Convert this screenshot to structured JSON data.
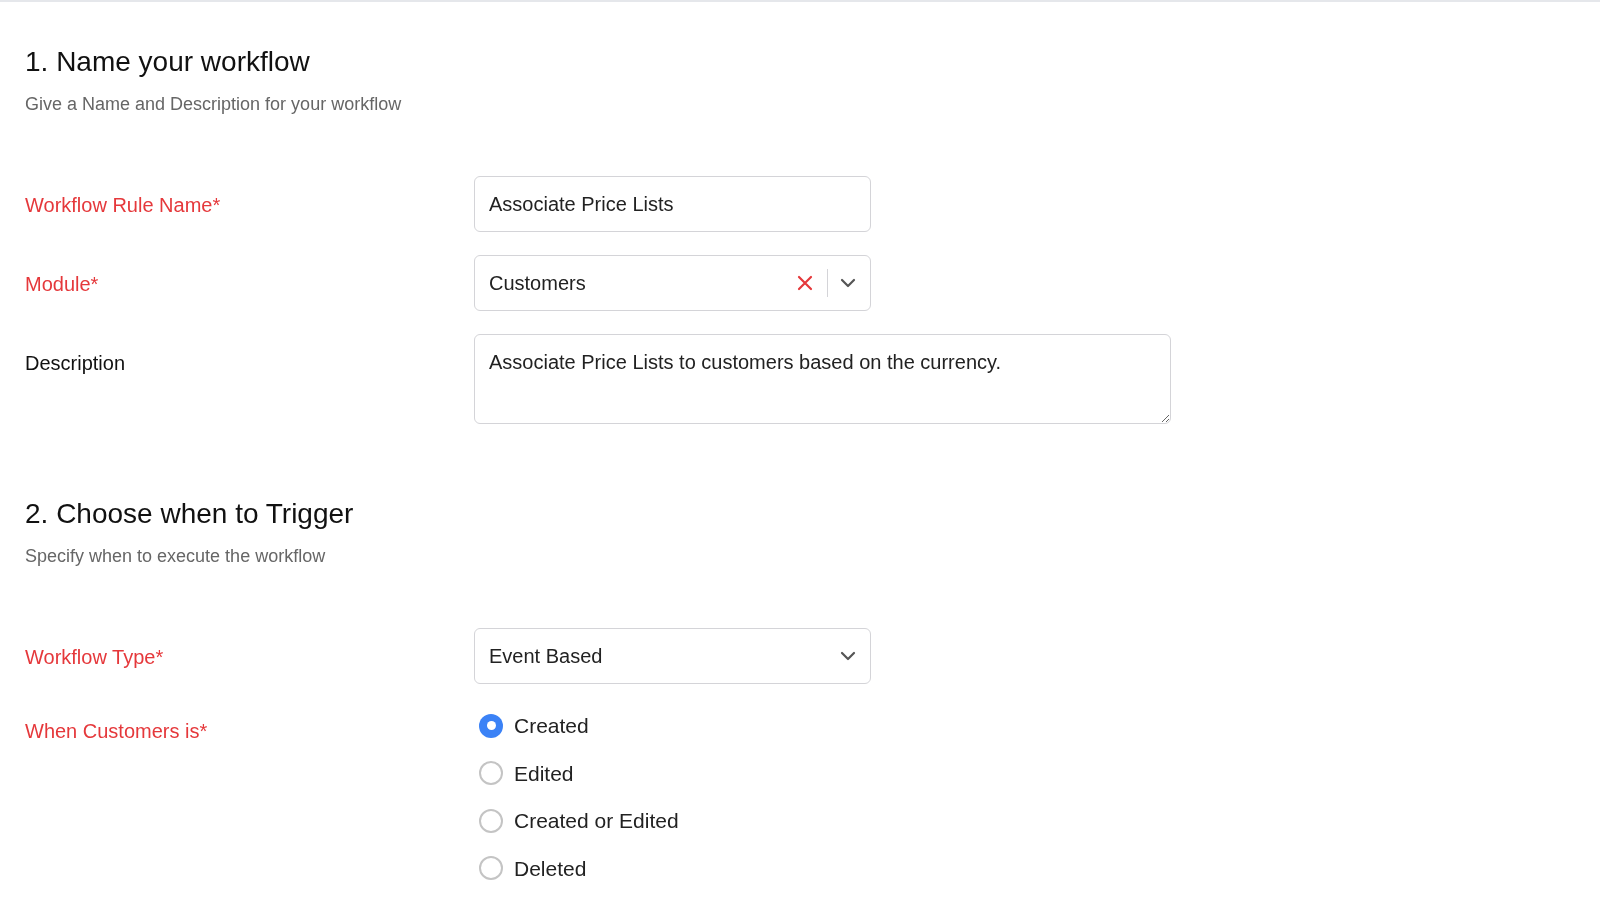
{
  "section_1": {
    "title": "1. Name your workflow",
    "subtitle": "Give a Name and Description for your workflow"
  },
  "fields_1": [
    {
      "kind": "text",
      "label": "Workflow Rule Name*",
      "required": true,
      "value": "Associate Price Lists"
    },
    {
      "kind": "select_clearable",
      "label": "Module*",
      "required": true,
      "value": "Customers"
    },
    {
      "kind": "textarea",
      "label": "Description",
      "required": false,
      "value": "Associate Price Lists to customers based on the currency."
    }
  ],
  "section_2": {
    "title": "2. Choose when to Trigger",
    "subtitle": "Specify when to execute the workflow"
  },
  "fields_2": [
    {
      "kind": "select",
      "label": "Workflow Type*",
      "required": true,
      "value": "Event Based"
    }
  ],
  "trigger": {
    "label": "When Customers is*",
    "required": true,
    "options": [
      {
        "label": "Created",
        "selected": true
      },
      {
        "label": "Edited",
        "selected": false
      },
      {
        "label": "Created or Edited",
        "selected": false
      },
      {
        "label": "Deleted",
        "selected": false
      }
    ]
  }
}
